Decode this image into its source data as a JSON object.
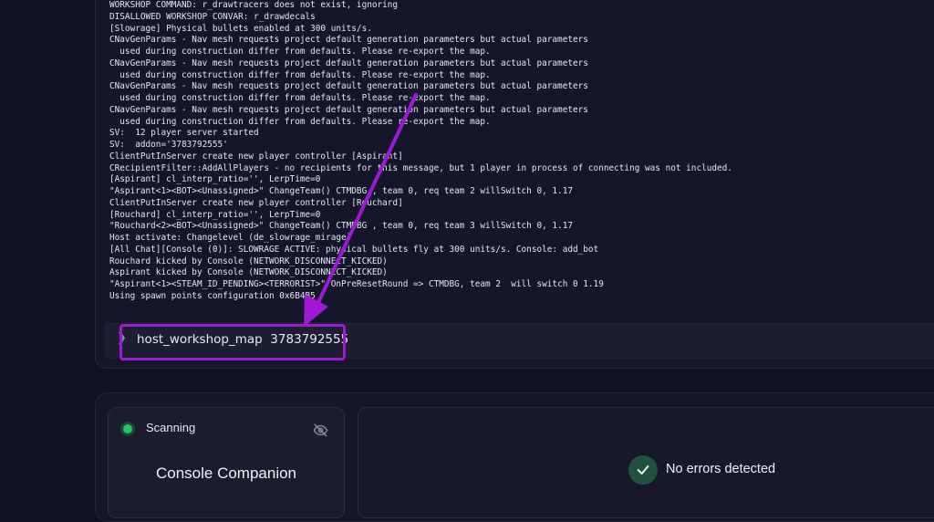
{
  "console": {
    "log_lines": [
      "WORKSHOP COMMAND: r_drawtracers does not exist, ignoring",
      "DISALLOWED WORKSHOP CONVAR: r_drawdecals",
      "[Slowrage] Physical bullets enabled at 300 units/s.",
      "CNavGenParams - Nav mesh requests project default generation parameters but actual parameters",
      "  used during construction differ from defaults. Please re-export the map.",
      "CNavGenParams - Nav mesh requests project default generation parameters but actual parameters",
      "  used during construction differ from defaults. Please re-export the map.",
      "CNavGenParams - Nav mesh requests project default generation parameters but actual parameters",
      "  used during construction differ from defaults. Please re-export the map.",
      "CNavGenParams - Nav mesh requests project default generation parameters but actual parameters",
      "  used during construction differ from defaults. Please re-export the map.",
      "SV:  12 player server started",
      "SV:  addon='3783792555'",
      "ClientPutInServer create new player controller [Aspirant]",
      "CRecipientFilter::AddAllPlayers - no recipients for this message, but 1 player in process of connecting was not included.",
      "[Aspirant] cl_interp_ratio='', LerpTime=0",
      "\"Aspirant<1><BOT><Unassigned>\" ChangeTeam() CTMDBG , team 0, req team 2 willSwitch 0, 1.17",
      "ClientPutInServer create new player controller [Rouchard]",
      "[Rouchard] cl_interp_ratio='', LerpTime=0",
      "\"Rouchard<2><BOT><Unassigned>\" ChangeTeam() CTMDBG , team 0, req team 3 willSwitch 0, 1.17",
      "Host activate: Changelevel (de_slowrage_mirage)",
      "[All Chat][Console (0)]: SLOWRAGE ACTIVE: physical bullets fly at 300 units/s. Console: add_bot",
      "Rouchard kicked by Console (NETWORK_DISCONNECT_KICKED)",
      "Aspirant kicked by Console (NETWORK_DISCONNECT_KICKED)",
      "\"Aspirant<1><STEAM_ID_PENDING><TERRORIST>\" OnPreResetRound => CTMDBG, team 2  will switch 0 1.19",
      "Using spawn points configuration 0x6B4B5"
    ],
    "prompt_icon": "chevron-right-icon",
    "input_value": "host_workshop_map  3783792555"
  },
  "annotation": {
    "highlight_color": "#9d19d6"
  },
  "status": {
    "label": "Scanning",
    "indicator_color": "#22c55e",
    "visibility_icon": "eye-off-icon",
    "title": "Console Companion"
  },
  "results": {
    "icon": "check-icon",
    "message": "No errors detected"
  }
}
